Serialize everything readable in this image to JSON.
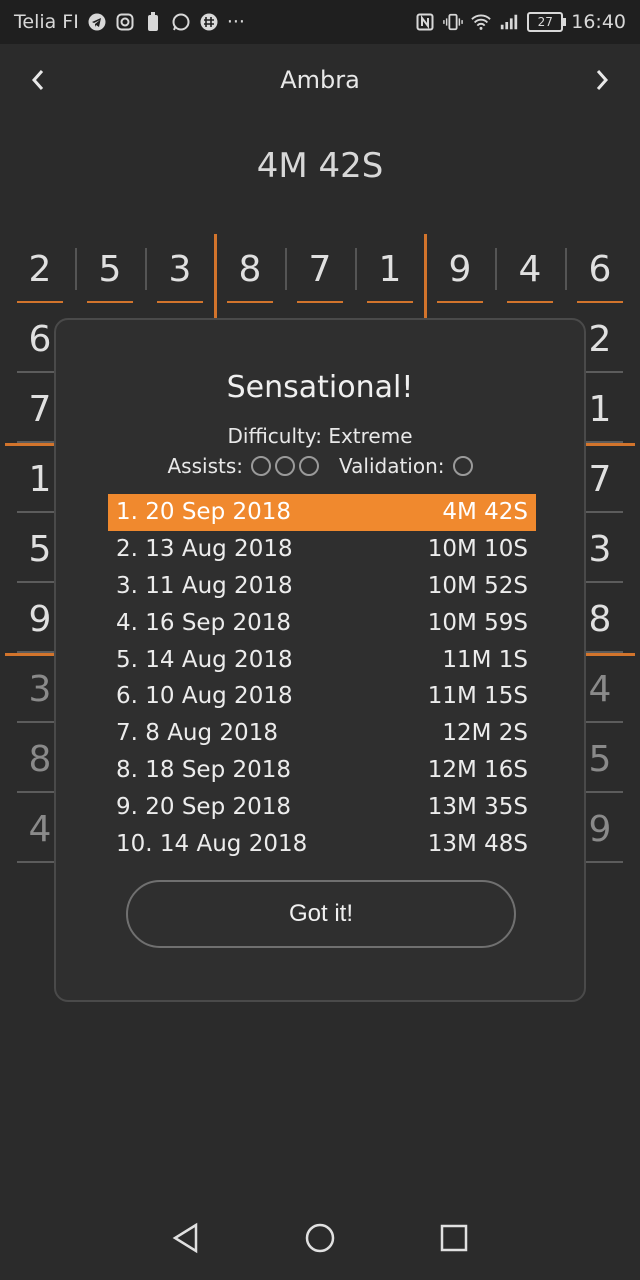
{
  "status_bar": {
    "carrier": "Telia FI",
    "left_icons": [
      "telegram-icon",
      "instagram-icon",
      "battery-saver-icon",
      "whatsapp-icon",
      "slack-icon"
    ],
    "more": "···",
    "right_icons": [
      "nfc-icon",
      "vibrate-icon",
      "wifi-icon",
      "signal-icon"
    ],
    "battery": "27",
    "time": "16:40"
  },
  "header": {
    "title": "Ambra"
  },
  "timer": "4M 42S",
  "grid": {
    "rows": [
      [
        "2",
        "5",
        "3",
        "8",
        "7",
        "1",
        "9",
        "4",
        "6"
      ],
      [
        "6",
        "",
        "",
        "",
        "",
        "",
        "",
        "",
        "2"
      ],
      [
        "7",
        "",
        "",
        "",
        "",
        "",
        "",
        "",
        "1"
      ],
      [
        "1",
        "",
        "",
        "",
        "",
        "",
        "",
        "",
        "7"
      ],
      [
        "5",
        "",
        "",
        "",
        "",
        "",
        "",
        "",
        "3"
      ],
      [
        "9",
        "",
        "",
        "",
        "",
        "",
        "",
        "",
        "8"
      ],
      [
        "3",
        "",
        "",
        "",
        "",
        "",
        "",
        "",
        "4"
      ],
      [
        "8",
        "",
        "",
        "",
        "",
        "",
        "",
        "",
        "5"
      ],
      [
        "4",
        "",
        "",
        "",
        "",
        "",
        "",
        "",
        "9"
      ]
    ]
  },
  "modal": {
    "headline": "Sensational!",
    "difficulty": "Difficulty: Extreme",
    "assists_label": "Assists:",
    "validation_label": "Validation:",
    "scores": [
      {
        "rank_date": "1. 20 Sep 2018",
        "time": "4M 42S"
      },
      {
        "rank_date": "2. 13 Aug 2018",
        "time": "10M 10S"
      },
      {
        "rank_date": "3. 11 Aug 2018",
        "time": "10M 52S"
      },
      {
        "rank_date": "4. 16 Sep 2018",
        "time": "10M 59S"
      },
      {
        "rank_date": "5. 14 Aug 2018",
        "time": "11M 1S"
      },
      {
        "rank_date": "6. 10 Aug 2018",
        "time": "11M 15S"
      },
      {
        "rank_date": "7. 8 Aug 2018",
        "time": "12M 2S"
      },
      {
        "rank_date": "8. 18 Sep 2018",
        "time": "12M 16S"
      },
      {
        "rank_date": "9. 20 Sep 2018",
        "time": "13M 35S"
      },
      {
        "rank_date": "10. 14 Aug 2018",
        "time": "13M 48S"
      }
    ],
    "button_label": "Got it!"
  },
  "colors": {
    "accent": "#f0892e",
    "background": "#2b2b2b",
    "modal": "#2f2f2f"
  }
}
